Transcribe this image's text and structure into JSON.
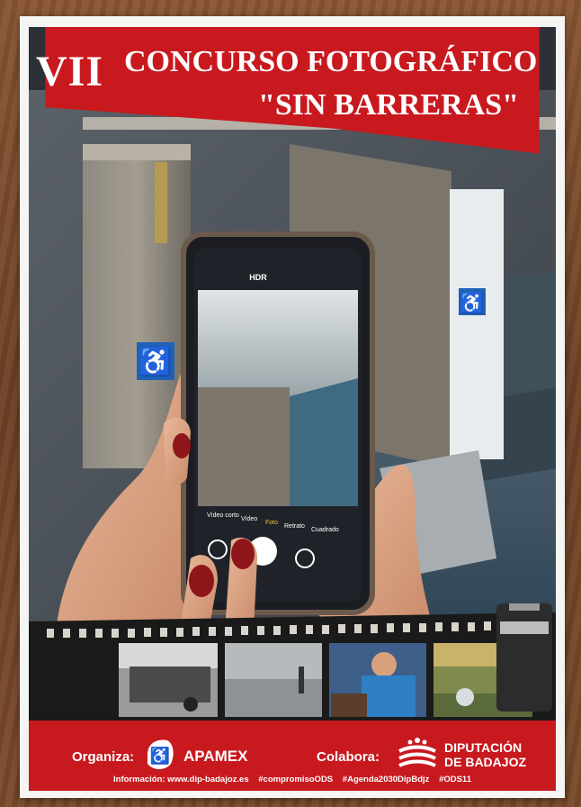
{
  "poster": {
    "roman": "VII",
    "title_line1": "CONCURSO FOTOGRÁFICO",
    "title_line2": "\"SIN BARRERAS\"",
    "phone_ui": {
      "hdr": "HDR",
      "modes": [
        "Vídeo corto",
        "Vídeo",
        "Foto",
        "Retrato",
        "Cuadrado"
      ]
    },
    "organiza_label": "Organiza:",
    "organiza_name": "APAMEX",
    "colabora_label": "Colabora:",
    "colabora_line1": "DIPUTACIÓN",
    "colabora_line2": "DE BADAJOZ",
    "info": {
      "website": "Información: www.dip-badajoz.es",
      "tags": [
        "#compromisoODS",
        "#Agenda2030DipBdjz",
        "#ODS11"
      ]
    }
  },
  "colors": {
    "brand_red": "#c8191f",
    "white": "#ffffff"
  },
  "icons": [
    "wheelchair-icon",
    "apamex-logo-icon",
    "diputacion-logo-icon"
  ]
}
